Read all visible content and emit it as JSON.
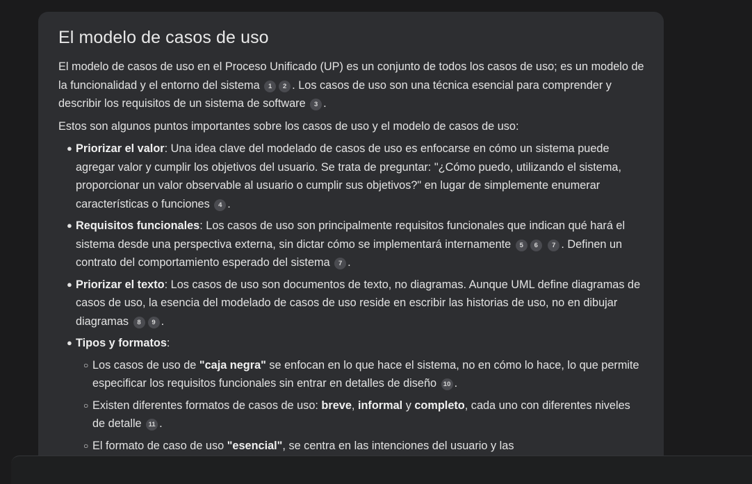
{
  "heading": "El modelo de casos de uso",
  "para1": {
    "t1": "El modelo de casos de uso en el Proceso Unificado (UP) es un conjunto de todos los casos de uso; es un modelo de la funcionalidad y el entorno del sistema",
    "c1": "1",
    "c2": "2",
    "t2": ". Los casos de uso son una técnica esencial para comprender y describir los requisitos de un sistema de software",
    "c3": "3",
    "t3": "."
  },
  "para2": "Estos son algunos puntos importantes sobre los casos de uso y el modelo de casos de uso:",
  "bullet_char": "●",
  "sub_bullet_char": "○",
  "items": [
    {
      "bold": "Priorizar el valor",
      "text": ": Una idea clave del modelado de casos de uso es enfocarse en cómo un sistema puede agregar valor y cumplir los objetivos del usuario. Se trata de preguntar: \"¿Cómo puedo, utilizando el sistema, proporcionar un valor observable al usuario o cumplir sus objetivos?\" en lugar de simplemente enumerar características o funciones",
      "c1": "4",
      "end": "."
    },
    {
      "bold": "Requisitos funcionales",
      "text": ": Los casos de uso son principalmente requisitos funcionales que indican qué hará el sistema desde una perspectiva externa, sin dictar cómo se implementará internamente",
      "c1": "5",
      "c2": "6",
      "c3": "7",
      "text2": ". Definen un contrato del comportamiento esperado del sistema",
      "c4": "7",
      "end": "."
    },
    {
      "bold": "Priorizar el texto",
      "text": ": Los casos de uso son documentos de texto, no diagramas. Aunque UML define diagramas de casos de uso, la esencia del modelado de casos de uso reside en escribir las historias de uso, no en dibujar diagramas",
      "c1": "8",
      "c2": "9",
      "end": "."
    },
    {
      "bold": "Tipos y formatos",
      "text": ":"
    }
  ],
  "subitems": [
    {
      "t1": "Los casos de uso de ",
      "b1": "\"caja negra\"",
      "t2": " se enfocan en lo que hace el sistema, no en cómo lo hace, lo que permite especificar los requisitos funcionales sin entrar en detalles de diseño",
      "c1": "10",
      "end": "."
    },
    {
      "t1": "Existen diferentes formatos de casos de uso: ",
      "b1": "breve",
      "s1": ", ",
      "b2": "informal",
      "s2": " y ",
      "b3": "completo",
      "t2": ", cada uno con diferentes niveles de detalle",
      "c1": "11",
      "end": "."
    },
    {
      "t1": "El formato de caso de uso ",
      "b1": "\"esencial\"",
      "t2": ", se centra en las intenciones del usuario y las"
    }
  ]
}
